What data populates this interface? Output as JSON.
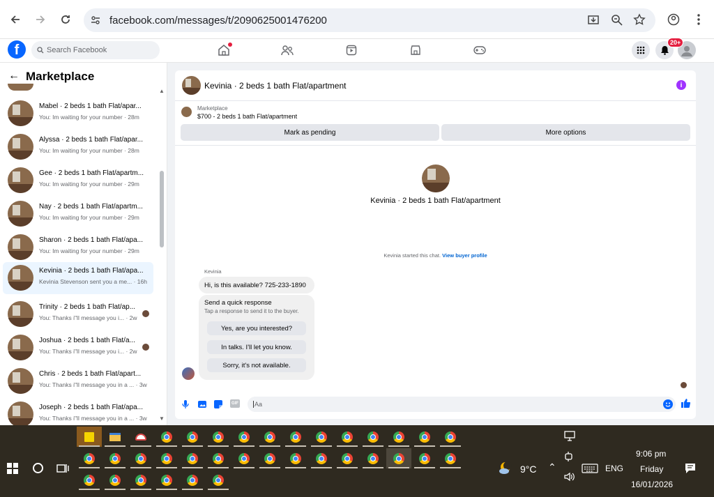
{
  "browser": {
    "url": "facebook.com/messages/t/2090625001476200"
  },
  "fb": {
    "search_placeholder": "Search Facebook",
    "notif_count": "20+"
  },
  "sidebar": {
    "title": "Marketplace",
    "conversations": [
      {
        "name": "Mabel · 2 beds 1 bath Flat/apar...",
        "preview": "You: Im waiting for your number · 28m",
        "active": false
      },
      {
        "name": "Alyssa · 2 beds 1 bath Flat/apar...",
        "preview": "You: Im waiting for your number · 28m",
        "active": false
      },
      {
        "name": "Gee · 2 beds 1 bath Flat/apartm...",
        "preview": "You: Im waiting for your number · 29m",
        "active": false
      },
      {
        "name": "Nay · 2 beds 1 bath Flat/apartm...",
        "preview": "You: Im waiting for your number · 29m",
        "active": false
      },
      {
        "name": "Sharon · 2 beds 1 bath Flat/apa...",
        "preview": "You: Im waiting for your number · 29m",
        "active": false
      },
      {
        "name": "Kevinia · 2 beds 1 bath Flat/apa...",
        "preview": "Kevinia Stevenson sent you a me... · 16h",
        "active": true
      },
      {
        "name": "Trinity · 2 beds 1 bath Flat/ap...",
        "preview": "You: Thanks i\"ll message you i... · 2w",
        "active": false
      },
      {
        "name": "Joshua · 2 beds 1 bath Flat/a...",
        "preview": "You: Thanks i\"ll message you i... · 2w",
        "active": false
      },
      {
        "name": "Chris · 2 beds 1 bath Flat/apart...",
        "preview": "You: Thanks i\"ll message you in a ... · 3w",
        "active": false
      },
      {
        "name": "Joseph · 2 beds 1 bath Flat/apa...",
        "preview": "You: Thanks i\"ll message you in a ... · 3w",
        "active": false
      }
    ]
  },
  "chat": {
    "title": "Kevinia · 2 beds 1 bath Flat/apartment",
    "marketplace_label": "Marketplace",
    "listing": "$700 - 2 beds 1 bath Flat/apartment",
    "mark_pending": "Mark as pending",
    "more_options": "More options",
    "profile_name": "Kevinia · 2 beds 1 bath Flat/apartment",
    "started_text": "Kevinia started this chat.",
    "view_buyer": "View buyer profile",
    "sender": "Kevinia",
    "message": "Hi, is this available? 725-233-1890",
    "quick_title": "Send a quick response",
    "quick_sub": "Tap a response to send it to the buyer.",
    "quick_responses": [
      "Yes, are you interested?",
      "In talks. I'll let you know.",
      "Sorry, it's not available."
    ],
    "composer_placeholder": "Aa"
  },
  "taskbar": {
    "weather": "9°C",
    "lang": "ENG",
    "time": "9:06 pm",
    "day": "Friday",
    "date": "16/01/2026"
  }
}
